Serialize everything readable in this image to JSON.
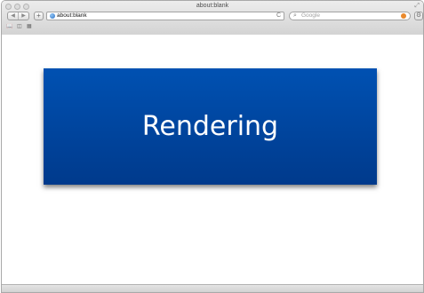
{
  "window": {
    "title": "about:blank"
  },
  "toolbar": {
    "back_label": "◀",
    "forward_label": "▶",
    "new_tab_label": "+",
    "url": "about:blank",
    "reload_label": "C",
    "search_placeholder": "Google",
    "settings_label": "⚙"
  },
  "bookmarks_bar": {
    "items": [
      "📖",
      "◫",
      "▦"
    ]
  },
  "content": {
    "box_text": "Rendering",
    "box_color": "#0047a3"
  }
}
